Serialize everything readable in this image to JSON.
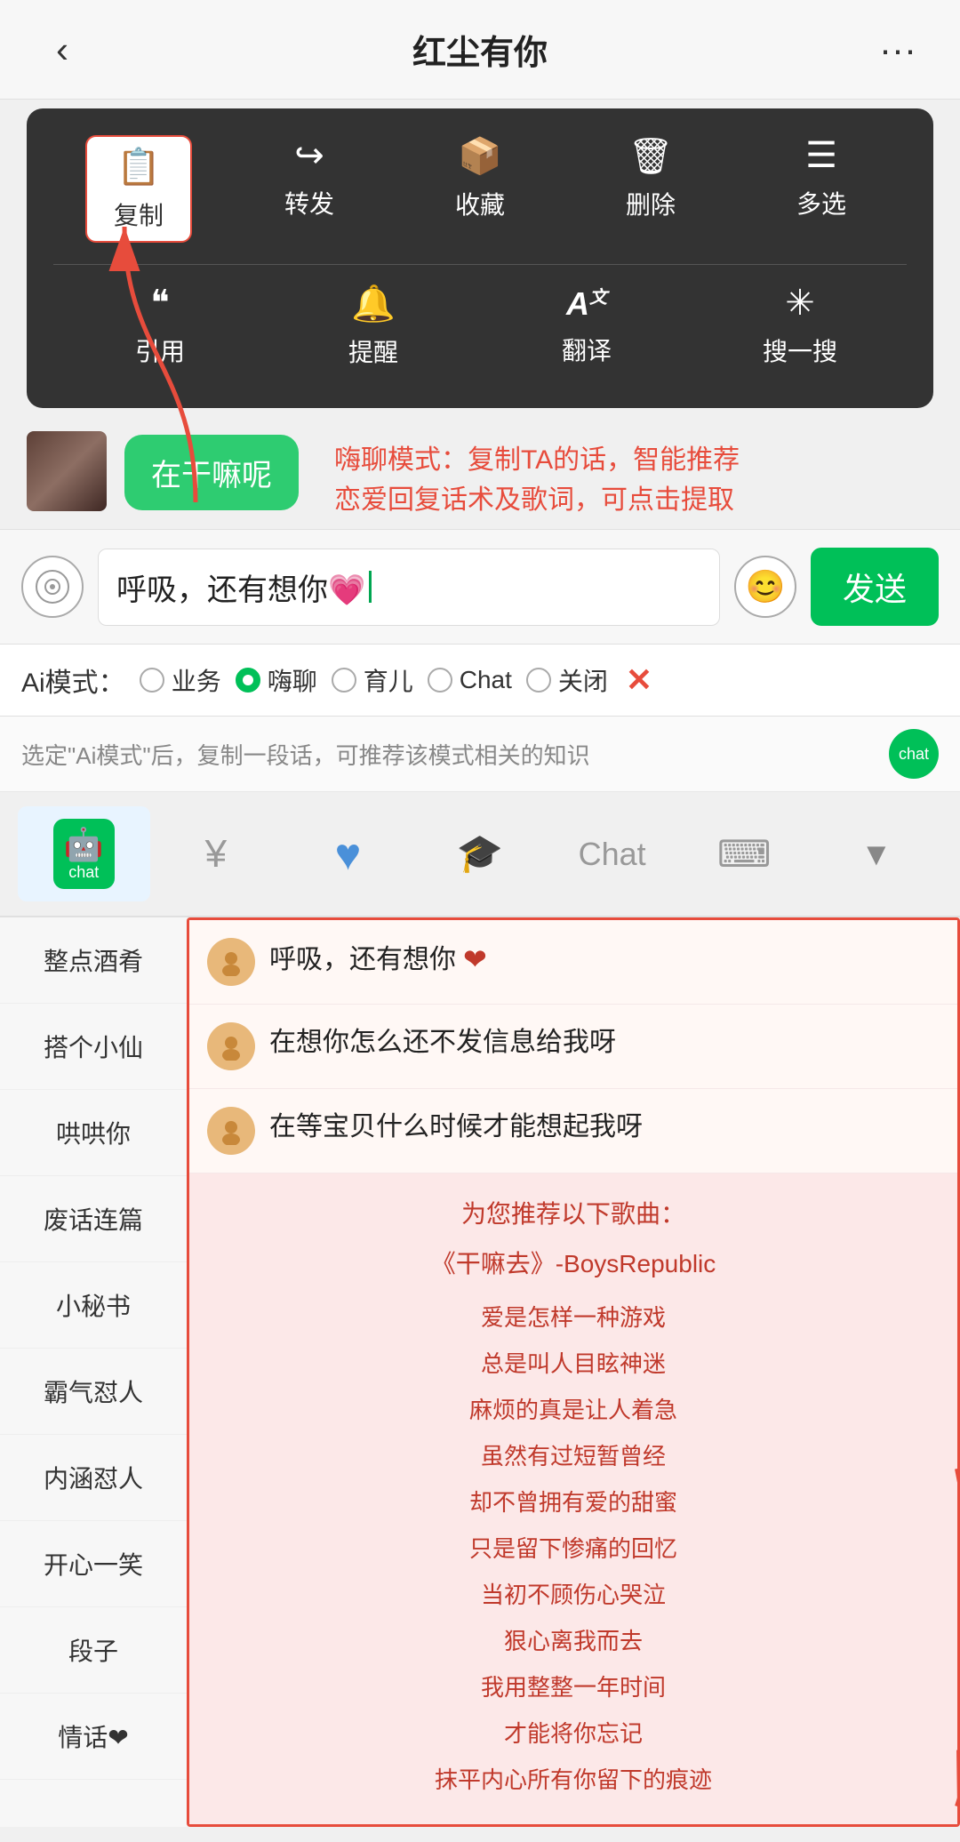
{
  "header": {
    "back_icon": "‹",
    "title": "红尘有你",
    "more_icon": "···"
  },
  "context_menu": {
    "row1": [
      {
        "icon": "📄",
        "label": "复制",
        "highlighted": true
      },
      {
        "icon": "↪",
        "label": "转发",
        "highlighted": false
      },
      {
        "icon": "📦",
        "label": "收藏",
        "highlighted": false
      },
      {
        "icon": "🗑",
        "label": "删除",
        "highlighted": false
      },
      {
        "icon": "☰",
        "label": "多选",
        "highlighted": false
      }
    ],
    "row2": [
      {
        "icon": "❝",
        "label": "引用"
      },
      {
        "icon": "🔔",
        "label": "提醒"
      },
      {
        "icon": "A",
        "label": "翻译"
      },
      {
        "icon": "✳",
        "label": "搜一搜"
      }
    ]
  },
  "chat_bubble": {
    "text": "在干嘛呢"
  },
  "annotation": {
    "text": "嗨聊模式：复制TA的话，智能推荐\n恋爱回复话术及歌词，可点击提取"
  },
  "input": {
    "text": "呼吸，还有想你💗",
    "emoji_icon": "😊",
    "send_label": "发送"
  },
  "ai_modes": {
    "label": "Ai模式：",
    "options": [
      {
        "label": "业务",
        "active": false
      },
      {
        "label": "嗨聊",
        "active": true
      },
      {
        "label": "育儿",
        "active": false
      },
      {
        "label": "Chat",
        "active": false
      },
      {
        "label": "关闭",
        "active": false
      }
    ],
    "close_icon": "✕"
  },
  "info_bar": {
    "text": "选定\"Ai模式\"后，复制一段话，可推荐该模式相关的知识"
  },
  "tabs": [
    {
      "icon": "🤖",
      "label": "chat",
      "active": true
    },
    {
      "icon": "¥",
      "label": "yuan"
    },
    {
      "icon": "♥",
      "label": "heart"
    },
    {
      "icon": "🎓",
      "label": "graduate"
    },
    {
      "icon": "Chat",
      "label": "chat-text"
    },
    {
      "icon": "⌨",
      "label": "keyboard"
    },
    {
      "icon": "▼",
      "label": "down"
    }
  ],
  "sidebar_items": [
    "整点酒肴",
    "搭个小仙",
    "哄哄你",
    "废话连篇",
    "小秘书",
    "霸气怼人",
    "内涵怼人",
    "开心一笑",
    "段子",
    "情话❤"
  ],
  "responses": [
    {
      "text": "呼吸，还有想你",
      "has_heart": true
    },
    {
      "text": "在想你怎么还不发信息给我呀"
    },
    {
      "text": "在等宝贝什么时候才能想起我呀"
    }
  ],
  "song_section": {
    "title": "为您推荐以下歌曲：",
    "song_name": "《干嘛去》-BoysRepublic",
    "lyrics": [
      "爱是怎样一种游戏",
      "总是叫人目眩神迷",
      "麻烦的真是让人着急",
      "虽然有过短暂曾经",
      "却不曾拥有爱的甜蜜",
      "只是留下惨痛的回忆",
      "当初不顾伤心哭泣",
      "狠心离我而去",
      "我用整整一年时间",
      "才能将你忘记",
      "抹平内心所有你留下的痕迹"
    ]
  }
}
